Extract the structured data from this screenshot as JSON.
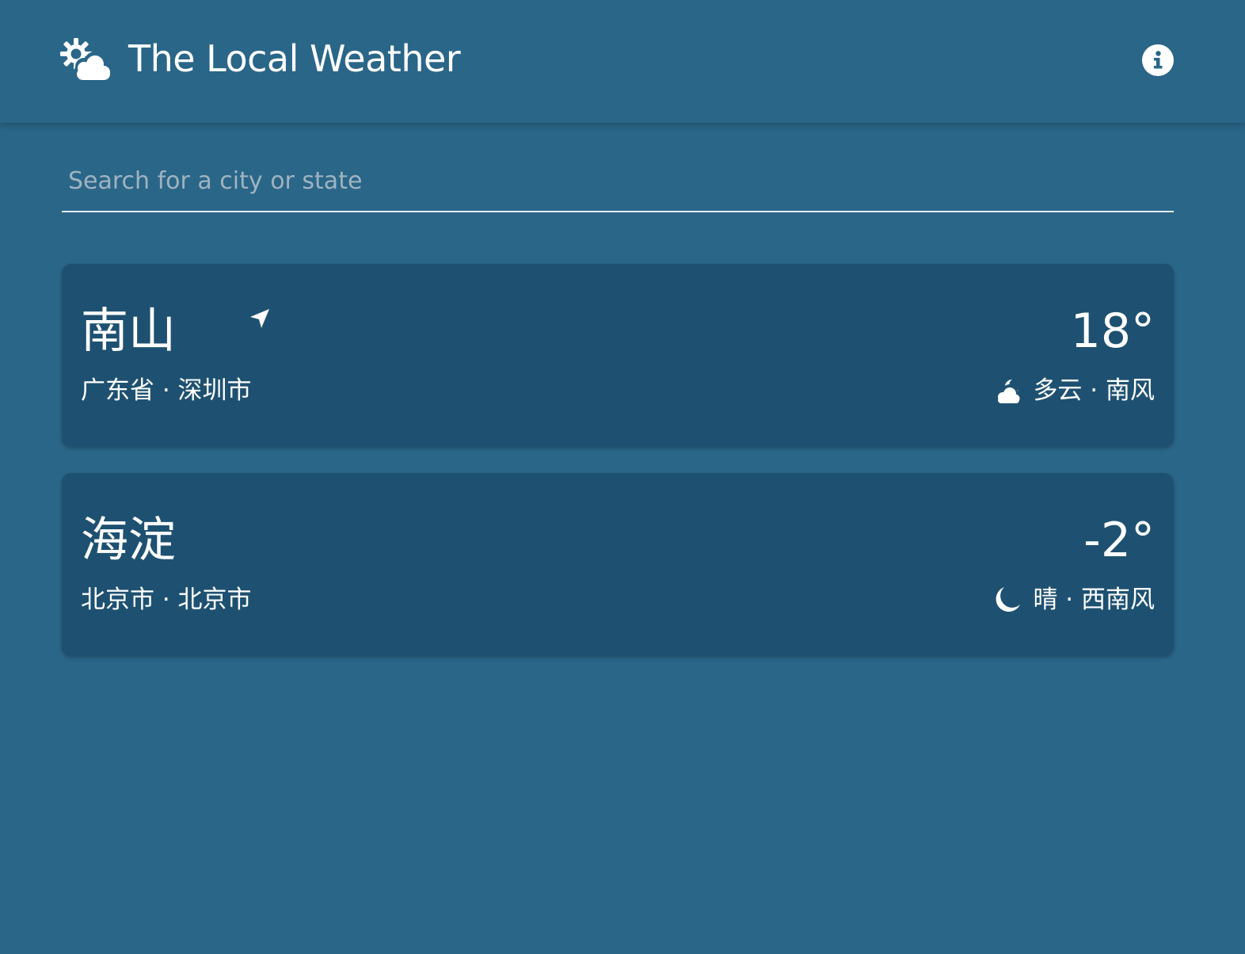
{
  "header": {
    "title": "The Local Weather",
    "logo_icon": "sun-cloud-icon",
    "info_icon": "info-icon"
  },
  "search": {
    "placeholder": "Search for a city or state",
    "value": ""
  },
  "colors": {
    "background": "#2a6688",
    "card": "#1e5171",
    "text": "#ffffff",
    "placeholder": "#9fb3c0"
  },
  "locations": [
    {
      "city": "南山",
      "current_location_icon": "navigation-arrow-icon",
      "region": "广东省 · 深圳市",
      "temperature": "18°",
      "condition_icon": "cloudy-night-icon",
      "condition": "多云 · 南风"
    },
    {
      "city": "海淀",
      "region": "北京市 · 北京市",
      "temperature": "-2°",
      "condition_icon": "moon-icon",
      "condition": "晴 · 西南风"
    }
  ]
}
